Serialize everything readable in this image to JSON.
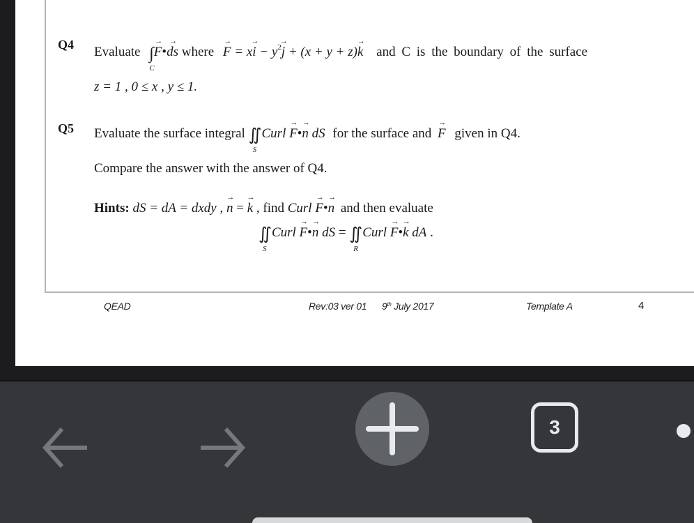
{
  "document": {
    "q4": {
      "label": "Q4",
      "evaluate": "Evaluate",
      "integral_sub": "C",
      "integrand_F": "F",
      "integrand_dot": "•",
      "integrand_ds": "ds",
      "where": "where",
      "F_def_lhs": "F",
      "F_def_eq": " = x",
      "i": "i",
      "minus_y": " − y",
      "sq": "2",
      "j": "j",
      "plus_xyz": " + (x + y + z)",
      "k": "k",
      "rest": "and  C  is  the  boundary  of  the  surface",
      "line2": "z = 1 , 0 ≤ x , y ≤ 1."
    },
    "q5": {
      "label": "Q5",
      "intro": "Evaluate the surface integral",
      "integral_sub": "S",
      "curl": "Curl",
      "F": "F",
      "dot": "•",
      "n": "n",
      "dS": "dS",
      "tail_a": "for the surface and",
      "tail_F": "F",
      "tail_b": "given in Q4.",
      "line2": "Compare the answer with the answer of Q4."
    },
    "hints": {
      "label": "Hints:",
      "eq1": "dS = dA = dxdy",
      "comma": ",",
      "n": "n",
      "eq_k": " = ",
      "k": "k",
      "find": ", find",
      "curl": "Curl",
      "F": "F",
      "dot": "•",
      "n2": "n",
      "then": "and then evaluate",
      "lhs_sub": "S",
      "rhs_sub": "R",
      "lhs_curl": "Curl",
      "lhs_F": "F",
      "lhs_dot": "•",
      "lhs_n": "n",
      "lhs_dS": "dS",
      "equals": " = ",
      "rhs_curl": "Curl",
      "rhs_F": "F",
      "rhs_dot": "•",
      "rhs_k": "k",
      "rhs_dA": "dA",
      "period": " ."
    },
    "footer": {
      "org": "QEAD",
      "revision": "Rev:03 ver 01",
      "date_day": "9",
      "date_ord": "th",
      "date_rest": " July 2017",
      "template": "Template A",
      "page_number": "4"
    }
  },
  "browser_toolbar": {
    "back_icon": "arrow-left",
    "forward_icon": "arrow-right",
    "new_tab_icon": "plus",
    "tab_count": "3",
    "menu_icon": "more-dots"
  },
  "colors": {
    "toolbar_bg": "#35363a",
    "new_tab_bg": "#5f6368",
    "icon_light": "#e8eaed",
    "icon_dim": "#77787b"
  }
}
